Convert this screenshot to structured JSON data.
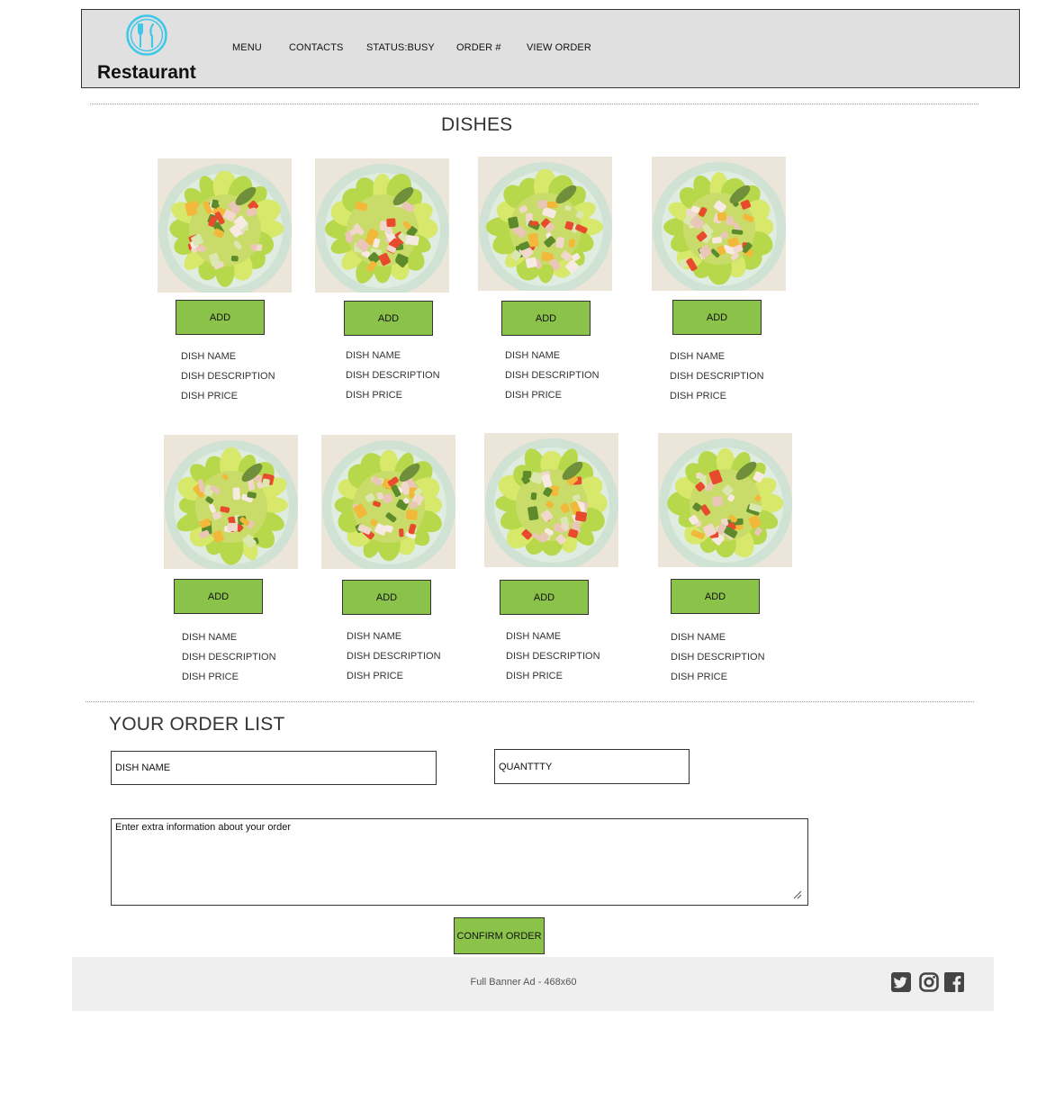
{
  "header": {
    "logo_text": "Restaurant",
    "nav": [
      "MENU",
      "CONTACTS",
      "STATUS:BUSY",
      "ORDER #",
      "VIEW ORDER"
    ]
  },
  "dishes": {
    "title": "DISHES",
    "add_label": "ADD",
    "name_label": "DISH NAME",
    "description_label": "DISH DESCRIPTION",
    "price_label": "DISH PRICE"
  },
  "order": {
    "title": "YOUR ORDER LIST",
    "dish_name_value": "DISH NAME",
    "quantity_value": "QUANTTTY",
    "extra_info_value": "Enter extra information about your order",
    "confirm_label": "CONFIRM ORDER"
  },
  "footer": {
    "banner_ad": "Full Banner Ad - 468x60",
    "social_icons": [
      "twitter-icon",
      "instagram-icon",
      "facebook-icon"
    ]
  },
  "colors": {
    "header_bg": "#e0e0e0",
    "button_green": "#8bc34a",
    "logo_accent": "#3fc7e8",
    "footer_bg": "#efefef"
  }
}
